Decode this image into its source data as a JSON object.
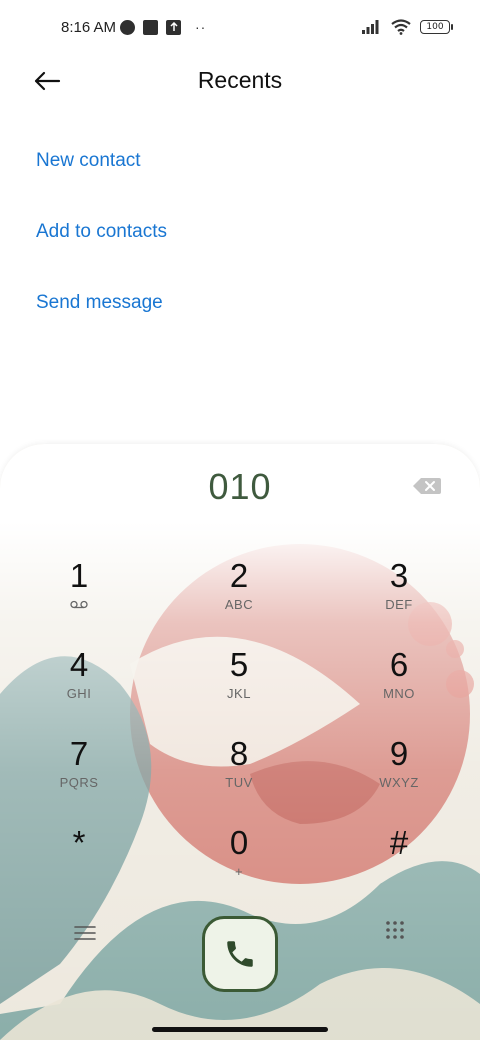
{
  "status_bar": {
    "time": "8:16 AM",
    "battery": "100",
    "icons": [
      "contrast-icon",
      "square-icon",
      "upload-icon",
      "more-dots-icon",
      "signal-icon",
      "wifi-icon",
      "battery-icon"
    ]
  },
  "header": {
    "title": "Recents",
    "back_icon": "arrow-left-icon"
  },
  "actions": {
    "new_contact": "New contact",
    "add_to_contacts": "Add to contacts",
    "send_message": "Send message"
  },
  "dialer": {
    "number": "010",
    "keys": [
      {
        "digit": "1",
        "letters": ""
      },
      {
        "digit": "2",
        "letters": "ABC"
      },
      {
        "digit": "3",
        "letters": "DEF"
      },
      {
        "digit": "4",
        "letters": "GHI"
      },
      {
        "digit": "5",
        "letters": "JKL"
      },
      {
        "digit": "6",
        "letters": "MNO"
      },
      {
        "digit": "7",
        "letters": "PQRS"
      },
      {
        "digit": "8",
        "letters": "TUV"
      },
      {
        "digit": "9",
        "letters": "WXYZ"
      },
      {
        "digit": "*",
        "letters": ""
      },
      {
        "digit": "0",
        "letters": "+"
      },
      {
        "digit": "#",
        "letters": ""
      }
    ],
    "icons": [
      "voicemail-icon",
      "backspace-icon",
      "menu-icon",
      "phone-icon",
      "keypad-icon"
    ]
  },
  "colors": {
    "accent": "#1976d2",
    "dial_number": "#3f5a3e",
    "call_border": "#3b5a35",
    "call_fill": "#eef3e8"
  }
}
